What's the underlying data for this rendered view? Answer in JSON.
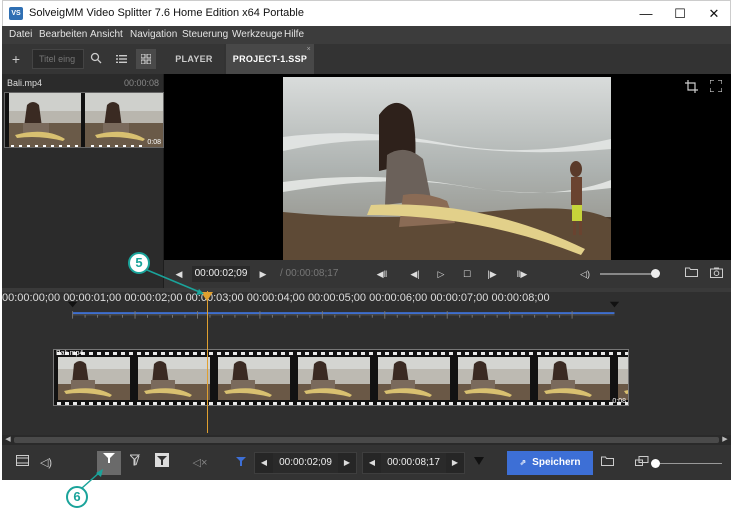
{
  "window": {
    "title": "SolveigMM Video Splitter 7.6 Home Edition x64 Portable",
    "app_icon_text": "VS",
    "minimize_glyph": "—",
    "maximize_glyph": "☐",
    "close_glyph": "✕"
  },
  "menu": {
    "items": [
      "Datei",
      "Bearbeiten",
      "Ansicht",
      "Navigation",
      "Steuerung",
      "Werkzeuge",
      "Hilfe"
    ]
  },
  "left_toolbar": {
    "add_glyph": "+",
    "search_placeholder": "Titel eing",
    "search_icon": "search-icon",
    "list_view_icon": "list-icon",
    "grid_view_icon": "grid-icon"
  },
  "media": {
    "file_name": "Bali.mp4",
    "duration": "00:00:08",
    "thumb_end": "0:08"
  },
  "tabs": {
    "player": "PLAYER",
    "project": "PROJECT-1.SSP",
    "close_glyph": "×"
  },
  "player": {
    "current_time": "00:00:02;09",
    "total_time": "/ 00:00:08;17",
    "volume_fraction": 0.88
  },
  "timeline": {
    "ticks": [
      "00:00:00;00",
      "00:00:01;00",
      "00:00:02;00",
      "00:00:03;00",
      "00:00:04;00",
      "00:00:05;00",
      "00:00:06;00",
      "00:00:07;00",
      "00:00:08;00"
    ],
    "clip_name": "Bali.mp4",
    "clip_end": "0:08",
    "playhead_time_fraction": 0.275
  },
  "bottom": {
    "marker_in_time": "00:00:02;09",
    "marker_out_time": "00:00:08;17",
    "save_label": "Speichern",
    "zoom_fraction": 0.0
  },
  "callouts": {
    "five": "5",
    "six": "6"
  },
  "colors": {
    "accent_blue": "#3d6fd6",
    "playhead": "#e0a030",
    "callout": "#1aa39a",
    "background": "#2b2b2b"
  }
}
